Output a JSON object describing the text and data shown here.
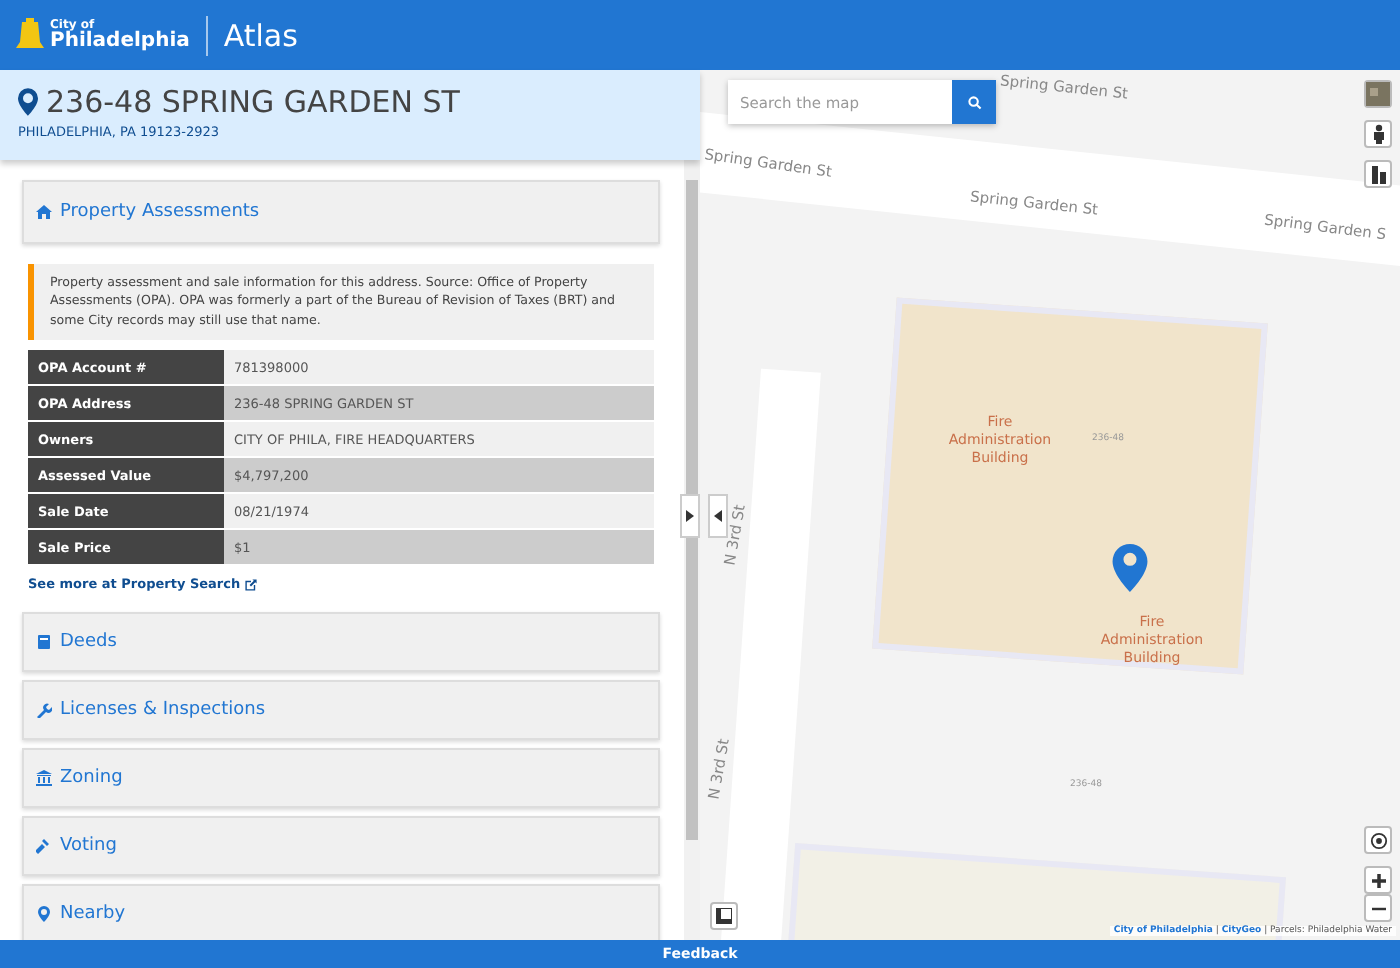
{
  "header": {
    "logo_small": "City of",
    "logo_large": "Philadelphia",
    "app_title": "Atlas"
  },
  "address": {
    "title": "236-48 SPRING GARDEN ST",
    "subtitle": "PHILADELPHIA, PA 19123-2923"
  },
  "topics": [
    {
      "kind": "home",
      "label": "Property Assessments",
      "expanded": true,
      "body": {
        "intro": "Property assessment and sale information for this address. Source: Office of Property Assessments (OPA). OPA was formerly a part of the Bureau of Revision of Taxes (BRT) and some City records may still use that name.",
        "rows": [
          {
            "label": "OPA Account #",
            "value": "781398000"
          },
          {
            "label": "OPA Address",
            "value": "236-48 SPRING GARDEN ST"
          },
          {
            "label": "Owners",
            "value": "CITY OF PHILA, FIRE HEADQUARTERS"
          },
          {
            "label": "Assessed Value",
            "value": "$4,797,200"
          },
          {
            "label": "Sale Date",
            "value": "08/21/1974"
          },
          {
            "label": "Sale Price",
            "value": "$1"
          }
        ],
        "link": "See more at Property Search"
      }
    },
    {
      "kind": "book",
      "label": "Deeds",
      "expanded": false
    },
    {
      "kind": "wrench",
      "label": "Licenses & Inspections",
      "expanded": false
    },
    {
      "kind": "bank",
      "label": "Zoning",
      "expanded": false
    },
    {
      "kind": "gavel",
      "label": "Voting",
      "expanded": false
    },
    {
      "kind": "pin",
      "label": "Nearby",
      "expanded": false
    }
  ],
  "map": {
    "search_placeholder": "Search the map",
    "street_labels": [
      "Spring Garden St",
      "Spring Garden St",
      "Spring Garden St",
      "Spring Garden S",
      "N 3rd St",
      "N 3rd St"
    ],
    "building_labels": [
      "Fire Administration Building",
      "Fire Administration Building"
    ],
    "parcel_labels": [
      "236-48",
      "236-48"
    ],
    "attribution": {
      "links": [
        "City of Philadelphia",
        "CityGeo"
      ],
      "separator": "|",
      "text": "Parcels: Philadelphia Water"
    }
  },
  "footer": {
    "label": "Feedback"
  }
}
